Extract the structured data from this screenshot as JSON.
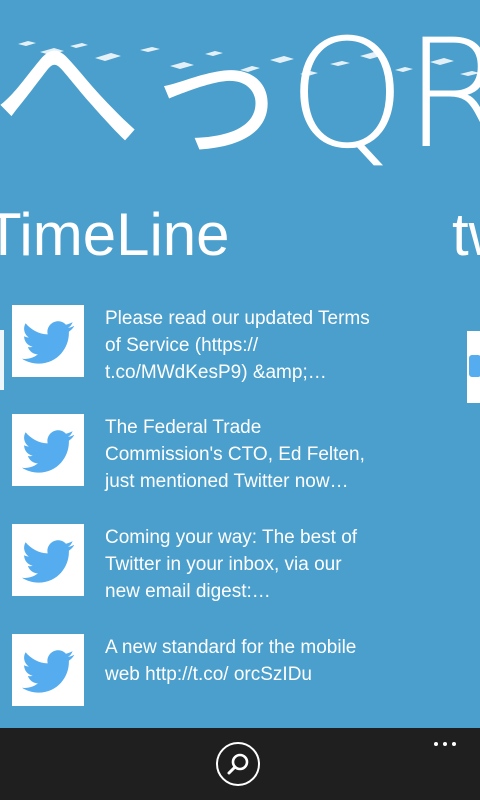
{
  "app": {
    "title": "へっQR",
    "sections": [
      {
        "label": "TimeLine"
      },
      {
        "label": "tw"
      }
    ]
  },
  "timeline": {
    "items": [
      {
        "icon": "twitter-bird-icon",
        "text": "Please read our updated Terms of Service (https:// t.co/MWdKesP9) &amp;…"
      },
      {
        "icon": "twitter-bird-icon",
        "text": "The Federal Trade Commission's CTO, Ed Felten, just mentioned Twitter now…"
      },
      {
        "icon": "twitter-bird-icon",
        "text": "Coming your way: The best of Twitter in your inbox, via our new email digest:…"
      },
      {
        "icon": "twitter-bird-icon",
        "text": "A new standard for the mobile web http://t.co/ orcSzIDu"
      }
    ]
  },
  "appbar": {
    "search_icon": "search-icon",
    "more_icon": "more-dots-icon"
  },
  "colors": {
    "background": "#4a9fcc",
    "appbar": "#1f1f1f",
    "twitter_blue": "#55acee",
    "text": "#ffffff"
  }
}
